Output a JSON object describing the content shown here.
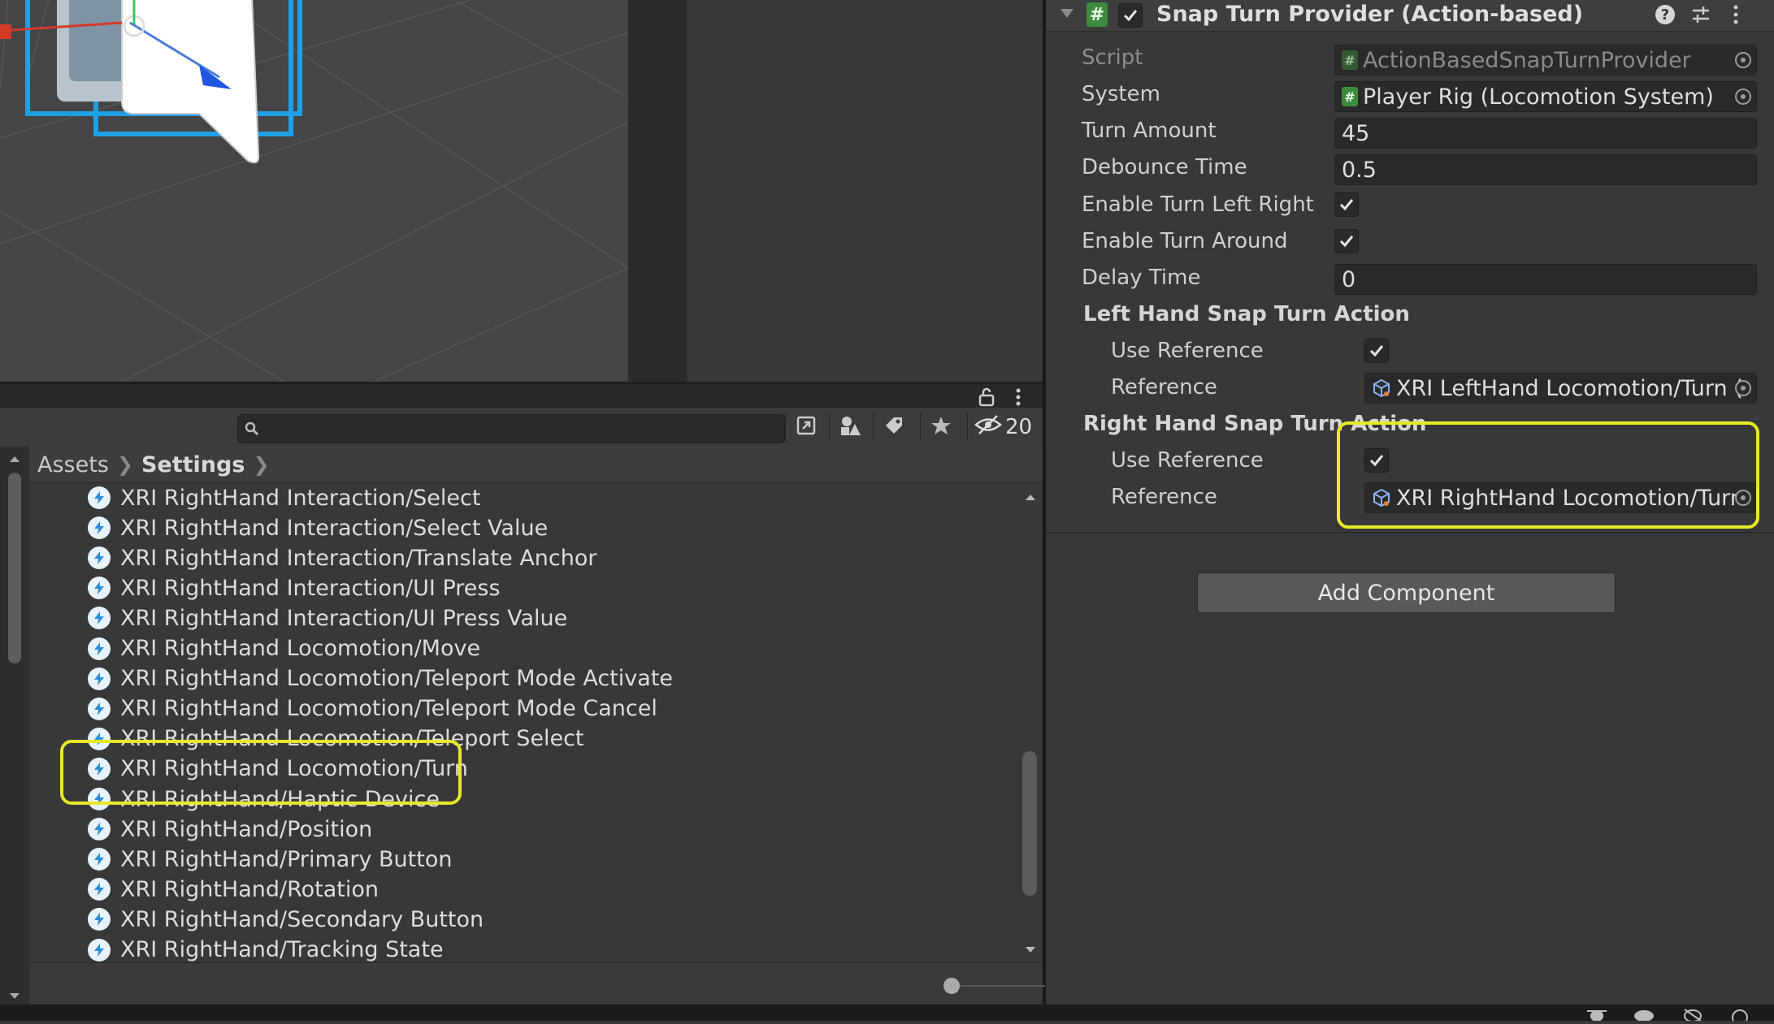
{
  "scene": {
    "description_icon": "scene-gizmo"
  },
  "project": {
    "search": {
      "value": "",
      "placeholder": ""
    },
    "hidden_count": "20",
    "breadcrumb": [
      "Assets",
      "Settings"
    ],
    "items": [
      "XRI RightHand Interaction/Select",
      "XRI RightHand Interaction/Select Value",
      "XRI RightHand Interaction/Translate Anchor",
      "XRI RightHand Interaction/UI Press",
      "XRI RightHand Interaction/UI Press Value",
      "XRI RightHand Locomotion/Move",
      "XRI RightHand Locomotion/Teleport Mode Activate",
      "XRI RightHand Locomotion/Teleport Mode Cancel",
      "XRI RightHand Locomotion/Teleport Select",
      "XRI RightHand Locomotion/Turn",
      "XRI RightHand/Haptic Device",
      "XRI RightHand/Position",
      "XRI RightHand/Primary Button",
      "XRI RightHand/Rotation",
      "XRI RightHand/Secondary Button",
      "XRI RightHand/Tracking State"
    ],
    "zoom_level": 0
  },
  "inspector": {
    "component_title": "Snap Turn Provider (Action-based)",
    "component_enabled": true,
    "script": {
      "label": "Script",
      "value": "ActionBasedSnapTurnProvider"
    },
    "system": {
      "label": "System",
      "value": "Player Rig (Locomotion System)"
    },
    "turn_amount": {
      "label": "Turn Amount",
      "value": "45"
    },
    "debounce_time": {
      "label": "Debounce Time",
      "value": "0.5"
    },
    "enable_turn_left_right": {
      "label": "Enable Turn Left Right",
      "checked": true
    },
    "enable_turn_around": {
      "label": "Enable Turn Around",
      "checked": true
    },
    "delay_time": {
      "label": "Delay Time",
      "value": "0"
    },
    "left_hand": {
      "section": "Left Hand Snap Turn Action",
      "use_reference_label": "Use Reference",
      "use_reference": true,
      "reference_label": "Reference",
      "reference_value": "XRI LeftHand Locomotion/Turn ("
    },
    "right_hand": {
      "section": "Right Hand Snap Turn Action",
      "use_reference_label": "Use Reference",
      "use_reference": true,
      "reference_label": "Reference",
      "reference_value": "XRI RightHand Locomotion/Turn"
    },
    "add_component": "Add Component"
  },
  "colors": {
    "highlight": "#e8e82a",
    "selection_blue": "#1fa0e6",
    "script_badge": "#3d8b3d"
  }
}
